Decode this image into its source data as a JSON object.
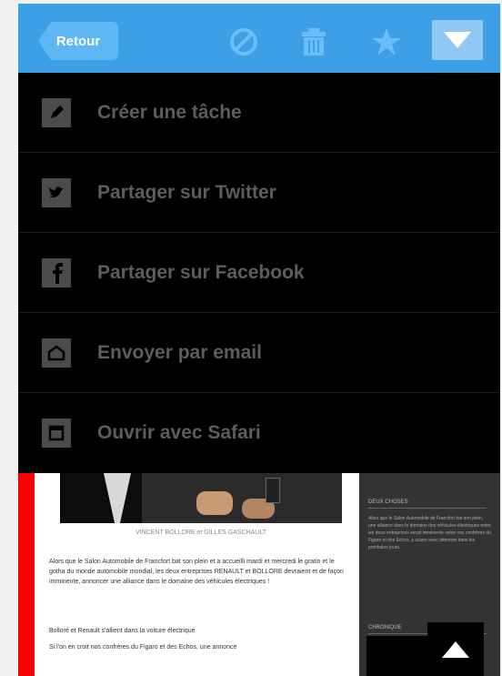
{
  "header": {
    "back_label": "Retour",
    "icons": [
      "block-icon",
      "trash-icon",
      "star-icon",
      "chevron-down-icon"
    ]
  },
  "menu": {
    "items": [
      {
        "label": "Créer une tâche",
        "icon": "pencil-icon"
      },
      {
        "label": "Partager sur Twitter",
        "icon": "twitter-icon"
      },
      {
        "label": "Partager sur Facebook",
        "icon": "facebook-icon"
      },
      {
        "label": "Envoyer par email",
        "icon": "email-icon"
      },
      {
        "label": "Ouvrir avec Safari",
        "icon": "safari-icon"
      }
    ]
  },
  "article": {
    "caption": "VINCENT BOLLORE et GILLES GASCHAULT",
    "paragraphs": [
      "Alors que le Salon Automobile de Francfort bat son plein et a accueilli mardi et mercredi le gratin et le gotha du monde automobile mondial, les deux entreprises RENAULT et BOLLORE devraient et de façon imminente, annoncer une alliance dans le domaine des véhicules électriques !",
      "Bolloré et Renault s'allient dans la voiture électrique",
      "Si l'on en croit nos confrères du Figaro et des Echos, une annonce"
    ]
  },
  "sidebar": {
    "title": "DEUX CHOSES",
    "text": "Alors que le Salon Automobile de Francfort bat son plein, une alliance dans le domaine des véhicules électriques entre les deux entreprises serait imminente selon nos confrères du Figaro et des Echos, à suivre avec attention dans les prochains jours.",
    "title2": "CHRONIQUE"
  },
  "colors": {
    "header_bg": "#3da0e6",
    "menu_bg": "#000000",
    "menu_text": "#5d5d5d",
    "accent_red": "#ff0000"
  }
}
